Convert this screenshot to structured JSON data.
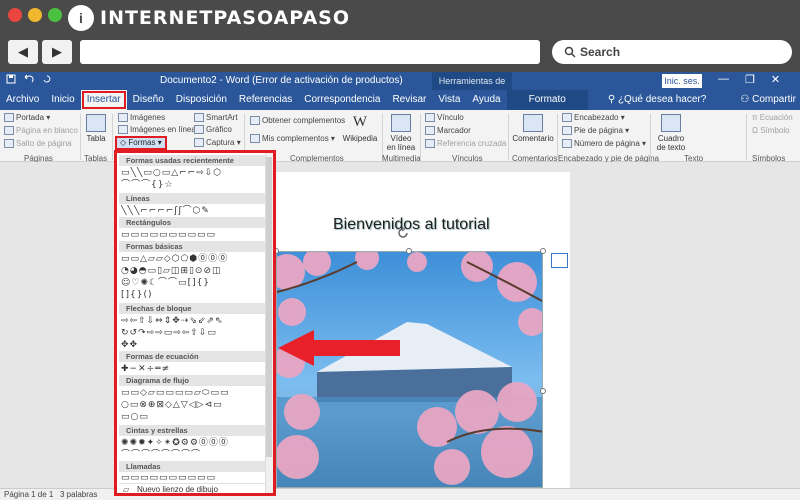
{
  "site": {
    "logo_letter": "i",
    "logo_text": "INTERNETPASOAPASO",
    "search_placeholder": "Search"
  },
  "browser": {
    "back_icon": "◀",
    "forward_icon": "▶"
  },
  "titlebar": {
    "document_title": "Documento2  -  Word (Error de activación de productos)",
    "tools_header": "Herramientas de imagen",
    "signin": "Inic. ses.",
    "minimize": "—",
    "restore": "❐",
    "close": "✕"
  },
  "tabs": [
    "Archivo",
    "Inicio",
    "Insertar",
    "Diseño",
    "Disposición",
    "Referencias",
    "Correspondencia",
    "Revisar",
    "Vista",
    "Ayuda"
  ],
  "format_tab": "Formato",
  "tell_me": "¿Qué desea hacer?",
  "share": "Compartir",
  "ribbon": {
    "paginas": {
      "portada": "Portada",
      "pagina_en_blanco": "Página en blanco",
      "salto": "Salto de página",
      "label": "Páginas"
    },
    "tablas": {
      "tabla": "Tabla",
      "label": "Tablas"
    },
    "ilustraciones": {
      "imagenes": "Imágenes",
      "imagenes_en_linea": "Imágenes en línea",
      "formas": "Formas",
      "smartart": "SmartArt",
      "grafico": "Gráfico",
      "captura": "Captura"
    },
    "complementos": {
      "obtener": "Obtener complementos",
      "mis": "Mis complementos",
      "wikipedia": "Wikipedia",
      "label": "Complementos"
    },
    "multimedia": {
      "video": "Vídeo en línea",
      "label": "Multimedia"
    },
    "vinculos": {
      "vinculo": "Vínculo",
      "marcador": "Marcador",
      "referencia": "Referencia cruzada",
      "label": "Vínculos"
    },
    "comentarios": {
      "comentario": "Comentario",
      "label": "Comentarios"
    },
    "encabezado": {
      "encabezado": "Encabezado",
      "pie": "Pie de página",
      "numero": "Número de página",
      "label": "Encabezado y pie de página"
    },
    "texto": {
      "cuadro": "Cuadro de texto",
      "label": "Texto"
    },
    "simbolos": {
      "ecuacion": "Ecuación",
      "simbolo": "Símbolo",
      "label": "Símbolos"
    }
  },
  "shapes_panel": {
    "categories": [
      "Formas usadas recientemente",
      "Líneas",
      "Rectángulos",
      "Formas básicas",
      "Flechas de bloque",
      "Formas de ecuación",
      "Diagrama de flujo",
      "Cintas y estrellas",
      "Llamadas"
    ],
    "rows": [
      "▭╲╲▭○▭△⌐⌐⇨⇩⬡",
      "⌒⌒⌒{}☆",
      "╲╲╲⌐⌐⌐⌐ʃʃ⌒⬡✎",
      "▭▭▭▭▭▭▭▭▭▭",
      "▭▭△▱▱◇⬡⬠⬢⓪⓪⓪",
      "◔◕◓▭▯▱◫⊞▯⊙⊘◫",
      "☺♡✺☾⌒⌒▭[]{}",
      "[]{}()",
      "⇨⇦⇧⇩⇔⇕✥⇢⇘⇙⇗⇖",
      "↻↺↷⇨⇨▭⇨⇦⇧⇩▭",
      "✥✥",
      "✚−✕÷═≠",
      "▭▭◇▱▭▭▭▭▱⬭▭▭",
      "○▭⊗⊕⊠◇△▽◁▷⊲▭",
      "▭○▭",
      "✺✺✹✦✧✴✪⚙⚙⓪⓪⓪",
      "⌒⌒⌒⌒⌒⌒⌒⌒",
      "▭▭▭▭▭▭▭▭▭▭"
    ],
    "footer": "Nuevo lienzo de dibujo"
  },
  "document": {
    "heading": "Bienvenidos al tutorial"
  },
  "status": {
    "page": "Página 1 de 1",
    "words": "3 palabras"
  },
  "colors": {
    "word_blue": "#2b579a",
    "highlight_red": "#e11b22",
    "arrow_red": "#e8202a"
  }
}
